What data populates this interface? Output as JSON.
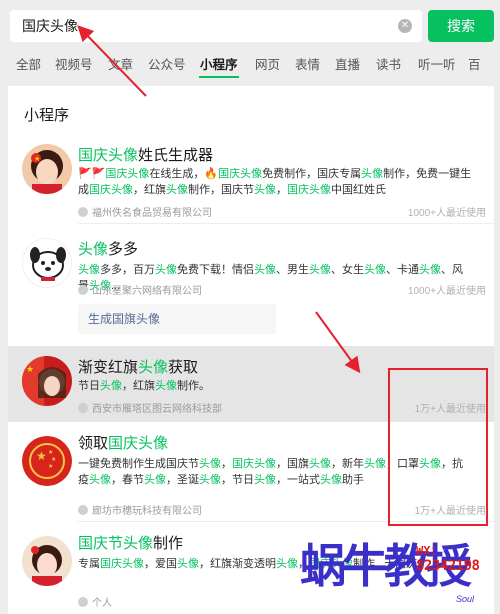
{
  "search": {
    "query": "国庆头像",
    "button_label": "搜索"
  },
  "tabs": [
    "全部",
    "视频号",
    "文章",
    "公众号",
    "小程序",
    "网页",
    "表情",
    "直播",
    "读书",
    "听一听",
    "百"
  ],
  "active_tab": "小程序",
  "section": {
    "title": "小程序"
  },
  "items": [
    {
      "title_hl": "国庆头像",
      "title_rest": "姓氏生成器",
      "desc": "🚩🚩国庆头像在线生成，🔥国庆头像免费制作，国庆专属头像制作，免费一键生成国庆头像，红旗头像制作，国庆节头像，国庆头像中国红姓氏",
      "meta": "福州佚名食品贸易有限公司",
      "count": "1000+人最近使用"
    },
    {
      "title_hl": "头像",
      "title_rest": "多多",
      "desc": "头像多多，百万头像免费下载！情侣头像、男生头像、女生头像、卡通头像、风景头像...",
      "meta": "山东星聚六网络有限公司",
      "count": "1000+人最近使用",
      "sub_action": "生成国旗头像"
    },
    {
      "title_pre": "渐变红旗",
      "title_hl": "头像",
      "title_rest": "获取",
      "desc": "节日头像，红旗头像制作。",
      "meta": "西安市雁塔区图云网络科技部",
      "count": "1万+人最近使用"
    },
    {
      "title_pre": "领取",
      "title_hl": "国庆头像",
      "title_rest": "",
      "desc": "一键免费制作生成国庆节头像，国庆头像，国旗头像，新年头像，口罩头像，抗疫头像，春节头像，圣诞头像，节日头像，一站式头像助手",
      "meta": "廊坊市穗玩科技有限公司",
      "count": "1万+人最近使用"
    },
    {
      "title_hl": "国庆节头像",
      "title_rest": "制作",
      "desc": "专属国庆头像，爱国头像，红旗渐变透明头像，国庆头像制作...天同庆！",
      "meta": "个人",
      "count": ""
    }
  ],
  "watermark": {
    "big_text": "蜗牛教授",
    "wx_label": "WX：",
    "wx_number": "82342198",
    "tag": "Soul"
  },
  "colors": {
    "accent": "#07c160",
    "annotation": "#e5202f",
    "watermark": "#3b2fc9"
  }
}
